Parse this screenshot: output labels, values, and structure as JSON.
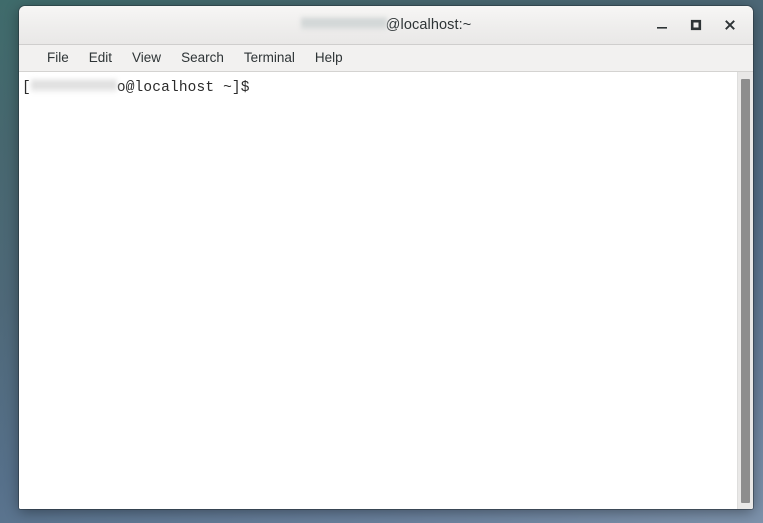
{
  "window": {
    "title_redacted_label": "redacted-username",
    "title_text": "@localhost:~",
    "buttons": {
      "minimize_label": "Minimize",
      "maximize_label": "Maximize",
      "close_label": "Close"
    }
  },
  "menubar": {
    "items": [
      {
        "label": "File",
        "name": "menu-item-file"
      },
      {
        "label": "Edit",
        "name": "menu-item-edit"
      },
      {
        "label": "View",
        "name": "menu-item-view"
      },
      {
        "label": "Search",
        "name": "menu-item-search"
      },
      {
        "label": "Terminal",
        "name": "menu-item-terminal"
      },
      {
        "label": "Help",
        "name": "menu-item-help"
      }
    ]
  },
  "terminal": {
    "prompt_prefix": "[",
    "prompt_redacted_label": "redacted-username",
    "prompt_suffix": "o@localhost ~]$ ",
    "output": ""
  },
  "colors": {
    "desktop_top": "#3f6b6b",
    "desktop_bottom": "#7d92ab",
    "titlebar": "#eeedec",
    "menubar": "#f2f1f0",
    "terminal_background": "#ffffff",
    "terminal_text": "#2b2b2b",
    "scrollbar_thumb": "#8d8d8d",
    "scrollbar_trough": "#e9e8e7"
  }
}
